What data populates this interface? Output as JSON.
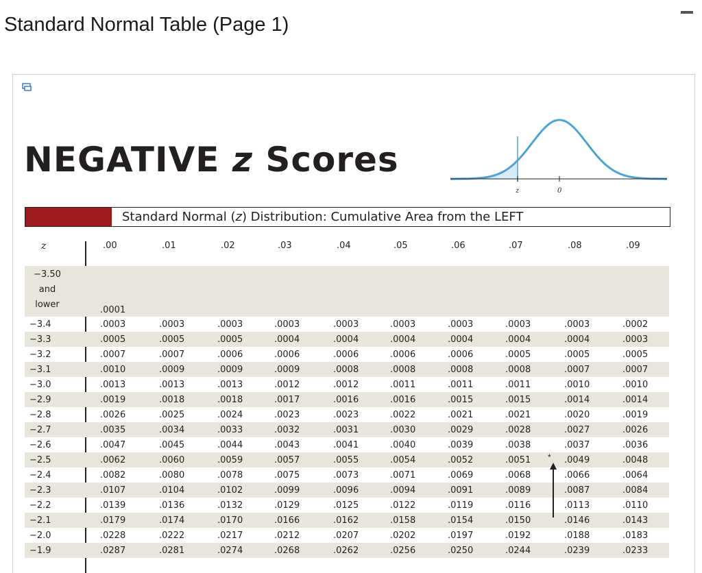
{
  "page": {
    "title": "Standard Normal Table (Page 1)"
  },
  "figure": {
    "heading_pre": "NEGATIVE ",
    "heading_z": "z",
    "heading_post": " Scores",
    "curve_labels": {
      "z": "z",
      "zero": "0"
    },
    "caption_pre": "Standard Normal (",
    "caption_z": "z",
    "caption_post": ") Distribution: Cumulative Area from the LEFT",
    "caption_color": "#9e1b1b",
    "curve_color": "#4fa3d1",
    "shade_color": "#d7ebf5",
    "row_shade_color": "#e8e6dc"
  },
  "table": {
    "z_header": "z",
    "columns": [
      ".00",
      ".01",
      ".02",
      ".03",
      ".04",
      ".05",
      ".06",
      ".07",
      ".08",
      ".09"
    ],
    "first_row": {
      "label_lines": [
        "−3.50",
        "and",
        "lower"
      ],
      "value": ".0001"
    },
    "rows": [
      {
        "z": "−3.4",
        "values": [
          ".0003",
          ".0003",
          ".0003",
          ".0003",
          ".0003",
          ".0003",
          ".0003",
          ".0003",
          ".0003",
          ".0002"
        ]
      },
      {
        "z": "−3.3",
        "values": [
          ".0005",
          ".0005",
          ".0005",
          ".0004",
          ".0004",
          ".0004",
          ".0004",
          ".0004",
          ".0004",
          ".0003"
        ]
      },
      {
        "z": "−3.2",
        "values": [
          ".0007",
          ".0007",
          ".0006",
          ".0006",
          ".0006",
          ".0006",
          ".0006",
          ".0005",
          ".0005",
          ".0005"
        ]
      },
      {
        "z": "−3.1",
        "values": [
          ".0010",
          ".0009",
          ".0009",
          ".0009",
          ".0008",
          ".0008",
          ".0008",
          ".0008",
          ".0007",
          ".0007"
        ]
      },
      {
        "z": "−3.0",
        "values": [
          ".0013",
          ".0013",
          ".0013",
          ".0012",
          ".0012",
          ".0011",
          ".0011",
          ".0011",
          ".0010",
          ".0010"
        ]
      },
      {
        "z": "−2.9",
        "values": [
          ".0019",
          ".0018",
          ".0018",
          ".0017",
          ".0016",
          ".0016",
          ".0015",
          ".0015",
          ".0014",
          ".0014"
        ]
      },
      {
        "z": "−2.8",
        "values": [
          ".0026",
          ".0025",
          ".0024",
          ".0023",
          ".0023",
          ".0022",
          ".0021",
          ".0021",
          ".0020",
          ".0019"
        ]
      },
      {
        "z": "−2.7",
        "values": [
          ".0035",
          ".0034",
          ".0033",
          ".0032",
          ".0031",
          ".0030",
          ".0029",
          ".0028",
          ".0027",
          ".0026"
        ]
      },
      {
        "z": "−2.6",
        "values": [
          ".0047",
          ".0045",
          ".0044",
          ".0043",
          ".0041",
          ".0040",
          ".0039",
          ".0038",
          ".0037",
          ".0036"
        ]
      },
      {
        "z": "−2.5",
        "values": [
          ".0062",
          ".0060",
          ".0059",
          ".0057",
          ".0055",
          ".0054",
          ".0052",
          ".0051",
          ".0049",
          ".0048"
        ]
      },
      {
        "z": "−2.4",
        "values": [
          ".0082",
          ".0080",
          ".0078",
          ".0075",
          ".0073",
          ".0071",
          ".0069",
          ".0068",
          ".0066",
          ".0064"
        ]
      },
      {
        "z": "−2.3",
        "values": [
          ".0107",
          ".0104",
          ".0102",
          ".0099",
          ".0096",
          ".0094",
          ".0091",
          ".0089",
          ".0087",
          ".0084"
        ]
      },
      {
        "z": "−2.2",
        "values": [
          ".0139",
          ".0136",
          ".0132",
          ".0129",
          ".0125",
          ".0122",
          ".0119",
          ".0116",
          ".0113",
          ".0110"
        ]
      },
      {
        "z": "−2.1",
        "values": [
          ".0179",
          ".0174",
          ".0170",
          ".0166",
          ".0162",
          ".0158",
          ".0154",
          ".0150",
          ".0146",
          ".0143"
        ]
      },
      {
        "z": "−2.0",
        "values": [
          ".0228",
          ".0222",
          ".0217",
          ".0212",
          ".0207",
          ".0202",
          ".0197",
          ".0192",
          ".0188",
          ".0183"
        ]
      },
      {
        "z": "−1.9",
        "values": [
          ".0287",
          ".0281",
          ".0274",
          ".0268",
          ".0262",
          ".0256",
          ".0250",
          ".0244",
          ".0239",
          ".0233"
        ]
      }
    ],
    "marker": {
      "symbol": "*"
    }
  }
}
